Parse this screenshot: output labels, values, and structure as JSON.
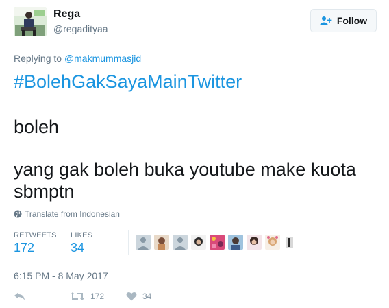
{
  "user": {
    "display_name": "Rega",
    "handle": "@regadityaa",
    "avatar_icon": "profile-photo"
  },
  "follow_button": {
    "label": "Follow",
    "icon": "add-user-icon"
  },
  "reply_context": {
    "prefix": "Replying to ",
    "mention": "@makmummasjid"
  },
  "tweet": {
    "hashtag": "#BolehGakSayaMainTwitter",
    "line1": "boleh",
    "line2": "yang gak boleh buka youtube make kuota",
    "line3": "sbmptn"
  },
  "translate": {
    "label": "Translate from Indonesian",
    "icon": "globe-icon"
  },
  "stats": {
    "retweets_label": "RETWEETS",
    "retweets_value": "172",
    "likes_label": "LIKES",
    "likes_value": "34"
  },
  "timestamp": "6:15 PM - 8 May 2017",
  "actions": {
    "reply_icon": "reply-icon",
    "retweet_icon": "retweet-icon",
    "retweet_count": "172",
    "like_icon": "heart-icon",
    "like_count": "34"
  },
  "colors": {
    "link": "#1b95e0",
    "muted": "#657786",
    "text": "#14171a"
  }
}
